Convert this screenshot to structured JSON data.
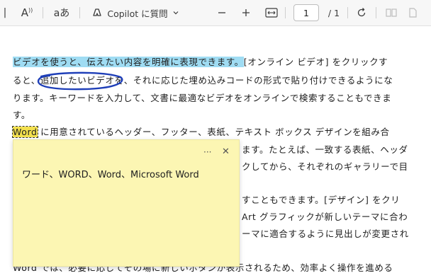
{
  "toolbar": {
    "read_aloud_icon_text": "A",
    "text_options_label": "aあ",
    "copilot_label": "Copilot に質問",
    "zoom_out_icon": "minus-icon",
    "zoom_in_icon": "plus-icon",
    "page_current": "1",
    "page_total": "/ 1"
  },
  "document": {
    "line1_highlight": "ビデオを使うと、伝えたい内容を明確に表現できます。",
    "line1_rest": "[オンライン ビデオ] をクリックす",
    "line2": "ると、追加したいビデオを、それに応じた埋め込みコードの形式で貼り付けできるようにな",
    "line3": "ります。キーワードを入力して、文書に最適なビデオをオンラインで検索することもできま",
    "line4": "す。",
    "line5_word": "Word",
    "line5_rest": " に用意されているヘッダー、フッター、表紙、テキスト ボックス デザインを組み合",
    "line6": "ます。たとえば、一致する表紙、ヘッダ",
    "line7": "クしてから、それぞれのギャラリーで目",
    "line8": "すこともできます。[デザイン] をクリ",
    "line9": "Art グラフィックが新しいテーマに合わ",
    "line10": "ーマに適合するように見出しが変更され",
    "line11": "Word では、必要に応じてその場に新しいボタンが表示されるため、効率よく操作を進める"
  },
  "note": {
    "text": "ワード、WORD、Word、Microsoft Word",
    "more_label": "···",
    "close_label": "✕"
  },
  "colors": {
    "highlight_blue": "#9fdcf3",
    "highlight_yellow": "#f3e04e",
    "ink_circle": "#1f3fb8",
    "note_bg": "#fcf6b3"
  }
}
